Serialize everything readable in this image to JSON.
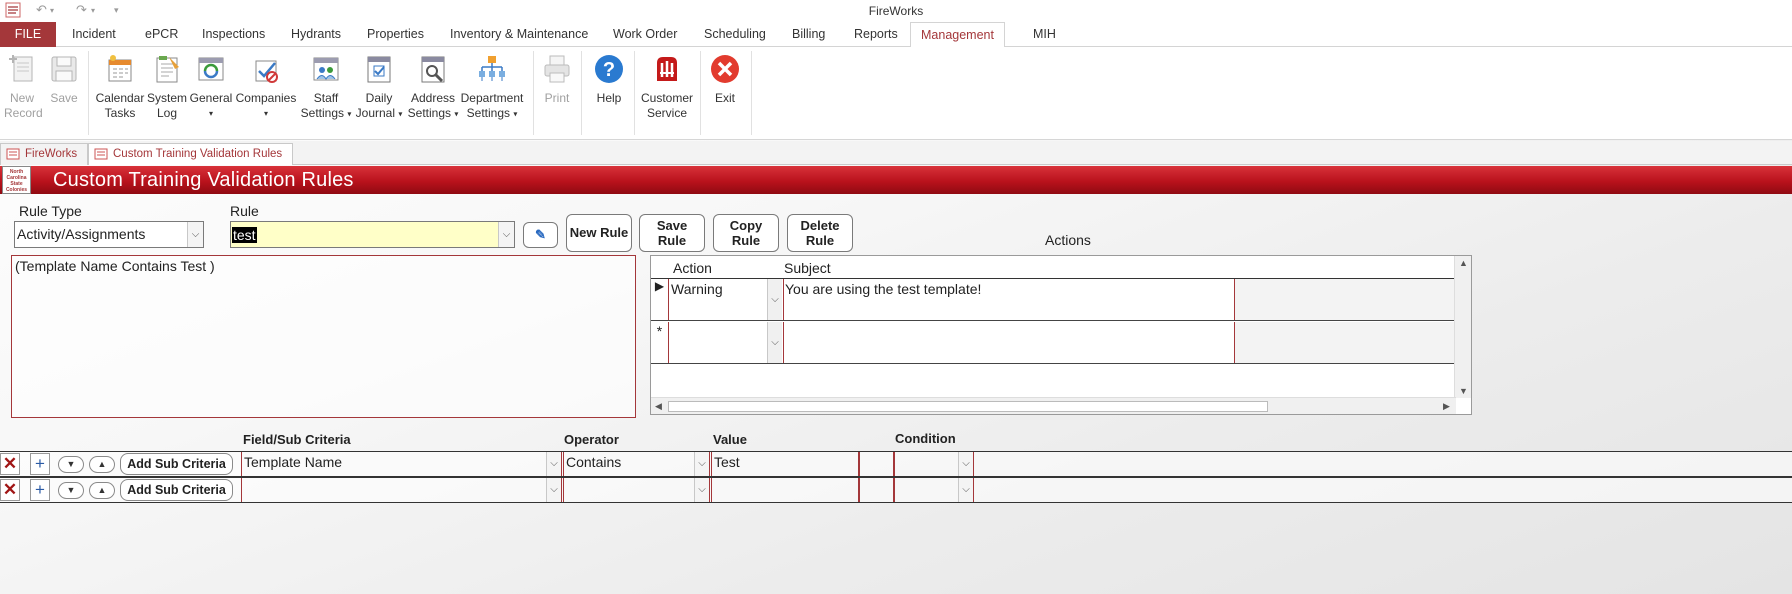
{
  "window": {
    "title": "FireWorks",
    "quick_access": [
      "undo",
      "redo",
      "customize"
    ]
  },
  "ribbon_tabs": [
    {
      "label": "FILE"
    },
    {
      "label": "Incident"
    },
    {
      "label": "ePCR"
    },
    {
      "label": "Inspections"
    },
    {
      "label": "Hydrants"
    },
    {
      "label": "Properties"
    },
    {
      "label": "Inventory & Maintenance"
    },
    {
      "label": "Work Order"
    },
    {
      "label": "Scheduling"
    },
    {
      "label": "Billing"
    },
    {
      "label": "Reports"
    },
    {
      "label": "Management"
    },
    {
      "label": "MIH"
    }
  ],
  "active_tab": "Management",
  "ribbon": {
    "new_record": {
      "line1": "New",
      "line2": "Record"
    },
    "save": {
      "line1": "Save"
    },
    "calendar_tasks": {
      "line1": "Calendar",
      "line2": "Tasks"
    },
    "system_log": {
      "line1": "System",
      "line2": "Log"
    },
    "general": {
      "line1": "General"
    },
    "companies": {
      "line1": "Companies"
    },
    "staff_settings": {
      "line1": "Staff",
      "line2": "Settings"
    },
    "daily_journal": {
      "line1": "Daily",
      "line2": "Journal"
    },
    "address_settings": {
      "line1": "Address",
      "line2": "Settings"
    },
    "department_settings": {
      "line1": "Department",
      "line2": "Settings"
    },
    "print": {
      "line1": "Print"
    },
    "help": {
      "line1": "Help"
    },
    "customer_service": {
      "line1": "Customer",
      "line2": "Service"
    },
    "exit": {
      "line1": "Exit"
    }
  },
  "doc_tabs": [
    {
      "label": "FireWorks"
    },
    {
      "label": "Custom Training Validation Rules"
    }
  ],
  "form": {
    "title": "Custom Training Validation Rules",
    "logo_text": "North Carolina State Colonies",
    "rule_type_label": "Rule Type",
    "rule_type_value": "Activity/Assignments",
    "rule_label": "Rule",
    "rule_value": "test",
    "buttons": {
      "new_rule": "New Rule",
      "save_rule_1": "Save",
      "save_rule_2": "Rule",
      "copy_rule_1": "Copy",
      "copy_rule_2": "Rule",
      "delete_rule_1": "Delete",
      "delete_rule_2": "Rule"
    },
    "expression": "(Template Name Contains Test  )",
    "actions_label": "Actions",
    "actions_table": {
      "columns": [
        "Action",
        "Subject"
      ],
      "rows": [
        {
          "action": "Warning",
          "subject": "You are using the test template!"
        },
        {
          "action": "",
          "subject": ""
        }
      ]
    },
    "criteria_headers": {
      "field": "Field/Sub Criteria",
      "operator": "Operator",
      "value": "Value",
      "condition": "Condition"
    },
    "criteria_rows": [
      {
        "field": "Template Name",
        "operator": "Contains",
        "value": "Test",
        "condition": "",
        "add_label": "Add Sub Criteria"
      },
      {
        "field": "",
        "operator": "",
        "value": "",
        "condition": "",
        "add_label": "Add Sub Criteria"
      }
    ]
  },
  "colors": {
    "accent": "#a4373a",
    "header_red": "#b9121c",
    "rule_highlight": "#ffffc8"
  }
}
